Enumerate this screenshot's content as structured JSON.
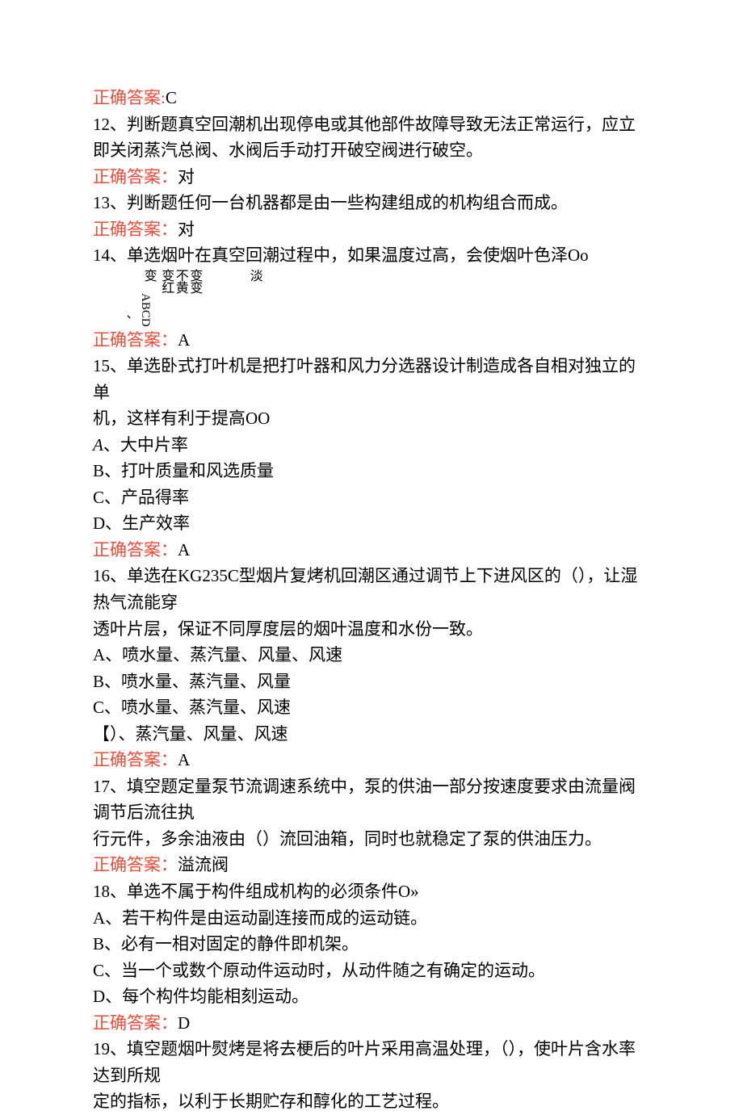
{
  "q11": {
    "answer_label": "正确答案:",
    "answer_value": "C"
  },
  "q12": {
    "text": "12、判断题真空回潮机出现停电或其他部件故障导致无法正常运行，应立即关闭蒸汽总阀、水阀后手动打开破空阀进行破空。",
    "answer_label": "正确答案：",
    "answer_value": "对"
  },
  "q13": {
    "text": "13、判断题任何一台机器都是由一些构建组成的机构组合而成。",
    "answer_label": "正确答案：",
    "answer_value": "对"
  },
  "q14": {
    "text": "14、单选烟叶在真空回潮过程中，如果温度过高，会使烟叶色泽Oo",
    "opt_top1": "变",
    "opt_top2": "变红",
    "opt_top3": "不黄",
    "opt_top4": "变变",
    "opt_bottom": "淡",
    "opt_labels": "ABCD",
    "comma": "、",
    "answer_label": "正确答案：",
    "answer_value": "A"
  },
  "q15": {
    "line1": "15、单选卧式打叶机是把打叶器和风力分选器设计制造成各自相对独立的单",
    "line2": "机，这样有利于提高OO",
    "optA_letter": "A",
    "optA_text": "、大中片率",
    "optB": "B、打叶质量和风选质量",
    "optC": "C、产品得率",
    "optD": "D、生产效率",
    "answer_label": "正确答案：",
    "answer_value": "A"
  },
  "q16": {
    "line1": "16、单选在KG235C型烟片复烤机回潮区通过调节上下进风区的（），让湿热气流能穿",
    "line2": "透叶片层，保证不同厚度层的烟叶温度和水份一致。",
    "optA": "A、喷水量、蒸汽量、风量、风速",
    "optB": "B、喷水量、蒸汽量、风量",
    "optC": "C、喷水量、蒸汽量、风速",
    "optD": "【）、蒸汽量、风量、风速",
    "answer_label": "正确答案：",
    "answer_value": "A"
  },
  "q17": {
    "line1": "17、填空题定量泵节流调速系统中，泵的供油一部分按速度要求由流量阀调节后流往执",
    "line2": "行元件，多余油液由（）流回油箱，同时也就稳定了泵的供油压力。",
    "answer_label": "正确答案：",
    "answer_value": "溢流阀"
  },
  "q18": {
    "text": "18、单选不属于构件组成机构的必须条件O»",
    "optA": "A、若干构件是由运动副连接而成的运动链。",
    "optB": "B、必有一相对固定的静件即机架。",
    "optC": "C、当一个或数个原动件运动时，从动件随之有确定的运动。",
    "optD": "D、每个构件均能相刻运动。",
    "answer_label": "正确答案：",
    "answer_value": "D"
  },
  "q19": {
    "line1": "19、填空题烟叶熨烤是将去梗后的叶片采用高温处理，（），使叶片含水率达到所规",
    "line2": "定的指标，以利于长期贮存和醇化的工艺过程。"
  }
}
